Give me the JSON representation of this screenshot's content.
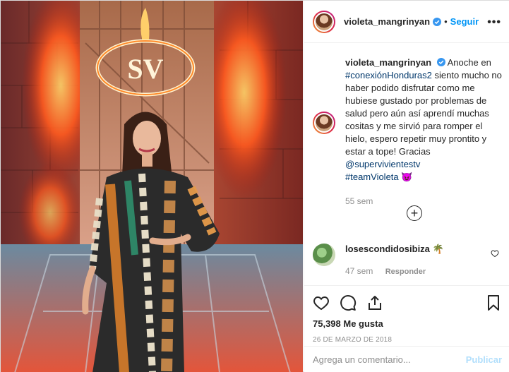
{
  "header": {
    "username": "violeta_mangrinyan",
    "dot": "•",
    "follow_label": "Seguir",
    "more_label": "•••"
  },
  "caption": {
    "username": "violeta_mangrinyan",
    "text_1": "Anoche en",
    "hashtag_1": "#conexiónHonduras2",
    "text_2": "siento mucho no haber podido disfrutar como me hubiese gustado por problemas de salud pero aún así aprendí muchas cositas y me sirvió para romper el hielo, espero repetir muy prontito y estar a tope! Gracias",
    "mention": "@supervivientestv",
    "hashtag_2": "#teamVioleta",
    "emoji": "😈",
    "time": "55 sem"
  },
  "load_more_symbol": "+",
  "reply": {
    "username": "losescondidosibiza",
    "emoji": "🌴",
    "time": "47 sem",
    "reply_label": "Responder"
  },
  "likes": "75,398 Me gusta",
  "date": "26 DE MARZO DE 2018",
  "add_comment": {
    "placeholder": "Agrega un comentario...",
    "publish_label": "Publicar"
  },
  "photo": {
    "logo_text": "SV"
  },
  "colors": {
    "link": "#00376b",
    "follow": "#0095f6",
    "publish_disabled": "#b2dffc",
    "verified": "#3897f0"
  }
}
